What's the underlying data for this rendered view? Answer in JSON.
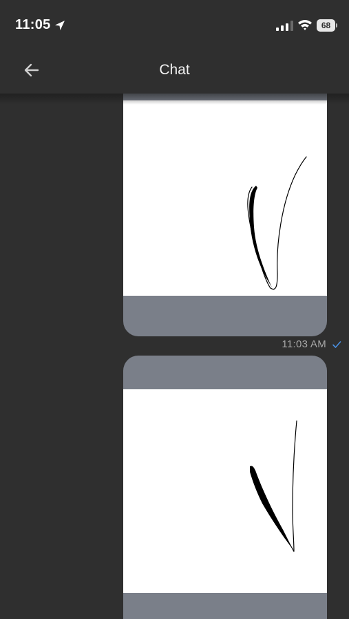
{
  "status_bar": {
    "time": "11:05",
    "battery_level": "68",
    "icons": [
      "location-arrow-icon",
      "cellular-signal-icon",
      "wifi-icon",
      "battery-icon"
    ]
  },
  "header": {
    "title": "Chat",
    "back_icon": "arrow-left-icon"
  },
  "messages": [
    {
      "kind": "image",
      "content": "signature-drawing",
      "time": "11:03 AM",
      "status": "read",
      "status_icon": "check-icon"
    },
    {
      "kind": "image",
      "content": "signature-drawing"
    }
  ],
  "colors": {
    "background": "#2f2f2f",
    "bubble": "#7a7f89",
    "canvas": "#ffffff",
    "accent": "#4a90e2",
    "timestamp": "#a8a8a8"
  }
}
